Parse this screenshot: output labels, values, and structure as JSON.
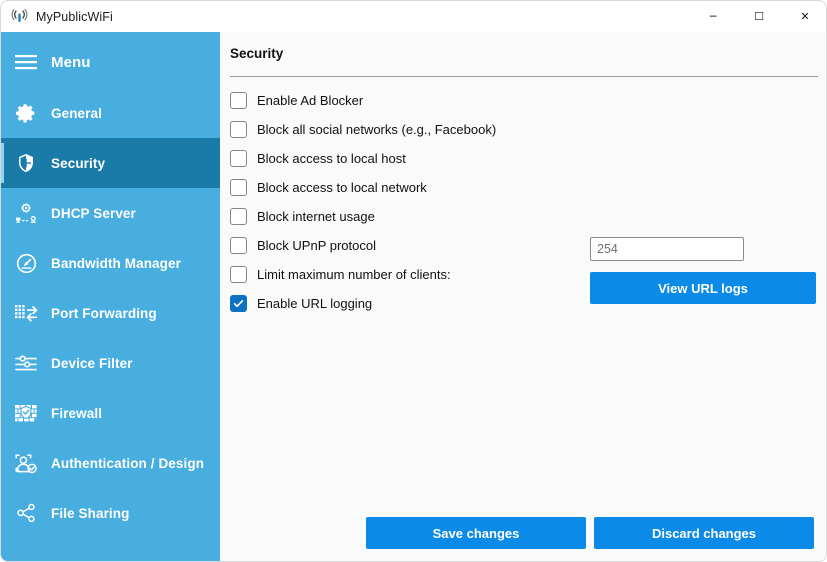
{
  "window": {
    "title": "MyPublicWiFi",
    "icon": "wifi-signal-icon",
    "controls": {
      "minimize": "─",
      "maximize": "☐",
      "close": "✕"
    }
  },
  "sidebar": {
    "background_color": "#48aee0",
    "active_background_color": "#1b7ba8",
    "accent_color": "#8fd3f0",
    "menu": {
      "label": "Menu",
      "icon": "hamburger-menu-icon"
    },
    "items": [
      {
        "label": "General",
        "icon": "gear-icon",
        "active": false
      },
      {
        "label": "Security",
        "icon": "shield-icon",
        "active": true
      },
      {
        "label": "DHCP Server",
        "icon": "dhcp-server-icon",
        "active": false
      },
      {
        "label": "Bandwidth Manager",
        "icon": "speedometer-icon",
        "active": false
      },
      {
        "label": "Port Forwarding",
        "icon": "port-forward-icon",
        "active": false
      },
      {
        "label": "Device Filter",
        "icon": "sliders-filter-icon",
        "active": false
      },
      {
        "label": "Firewall",
        "icon": "firewall-brick-icon",
        "active": false
      },
      {
        "label": "Authentication / Design",
        "icon": "user-auth-icon",
        "active": false
      },
      {
        "label": "File Sharing",
        "icon": "share-nodes-icon",
        "active": false
      }
    ]
  },
  "main": {
    "title": "Security",
    "options": [
      {
        "label": "Enable Ad Blocker",
        "checked": false
      },
      {
        "label": "Block all social networks (e.g., Facebook)",
        "checked": false
      },
      {
        "label": "Block access to local host",
        "checked": false
      },
      {
        "label": "Block access to local network",
        "checked": false
      },
      {
        "label": "Block internet usage",
        "checked": false
      },
      {
        "label": "Block UPnP protocol",
        "checked": false
      },
      {
        "label": "Limit maximum number of clients:",
        "checked": false
      },
      {
        "label": "Enable URL logging",
        "checked": true
      }
    ],
    "max_clients_field": {
      "value": "254",
      "placeholder": "254"
    },
    "view_logs_button": {
      "label": "View URL logs",
      "color": "#0b8ae8"
    }
  },
  "footer": {
    "save_label": "Save changes",
    "discard_label": "Discard changes",
    "button_color": "#0b8ae8"
  }
}
